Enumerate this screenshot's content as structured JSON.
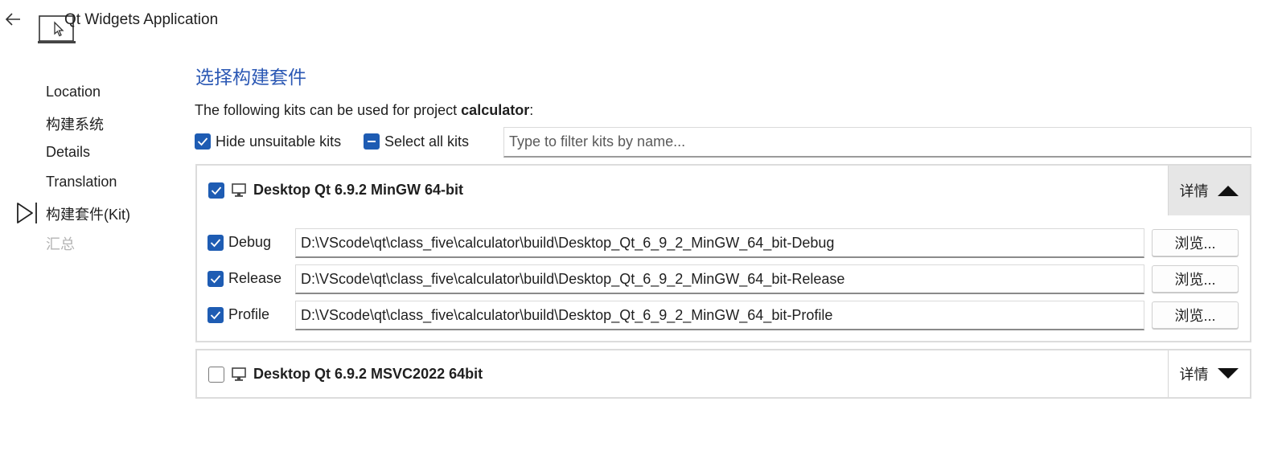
{
  "header": {
    "title": "Qt Widgets Application",
    "back_icon": "arrow-left-icon",
    "app_icon": "laptop-cursor-icon"
  },
  "nav": {
    "items": [
      {
        "label": "Location",
        "state": "normal"
      },
      {
        "label": "构建系统",
        "state": "normal"
      },
      {
        "label": "Details",
        "state": "normal"
      },
      {
        "label": "Translation",
        "state": "normal"
      },
      {
        "label": "构建套件(Kit)",
        "state": "current"
      },
      {
        "label": "汇总",
        "state": "disabled"
      }
    ]
  },
  "main": {
    "title": "选择构建套件",
    "intro_prefix": "The following kits can be used for project ",
    "project_name": "calculator",
    "intro_suffix": ":",
    "hide_unsuitable": {
      "label": "Hide unsuitable kits",
      "checked": true
    },
    "select_all": {
      "label": "Select all kits",
      "state": "partial"
    },
    "filter": {
      "placeholder": "Type to filter kits by name...",
      "value": ""
    }
  },
  "kits": [
    {
      "name": "Desktop Qt 6.9.2 MinGW 64-bit",
      "checked": true,
      "expanded": true,
      "details_label": "详情",
      "builds": [
        {
          "label": "Debug",
          "checked": true,
          "path": "D:\\VScode\\qt\\class_five\\calculator\\build\\Desktop_Qt_6_9_2_MinGW_64_bit-Debug",
          "browse": "浏览..."
        },
        {
          "label": "Release",
          "checked": true,
          "path": "D:\\VScode\\qt\\class_five\\calculator\\build\\Desktop_Qt_6_9_2_MinGW_64_bit-Release",
          "browse": "浏览..."
        },
        {
          "label": "Profile",
          "checked": true,
          "path": "D:\\VScode\\qt\\class_five\\calculator\\build\\Desktop_Qt_6_9_2_MinGW_64_bit-Profile",
          "browse": "浏览..."
        }
      ]
    },
    {
      "name": "Desktop Qt 6.9.2 MSVC2022 64bit",
      "checked": false,
      "expanded": false,
      "details_label": "详情"
    }
  ],
  "colors": {
    "accent": "#1e5cb3",
    "title": "#2b58b4",
    "disabled_text": "#b4b4b4",
    "details_active_bg": "#e6e6e6"
  }
}
